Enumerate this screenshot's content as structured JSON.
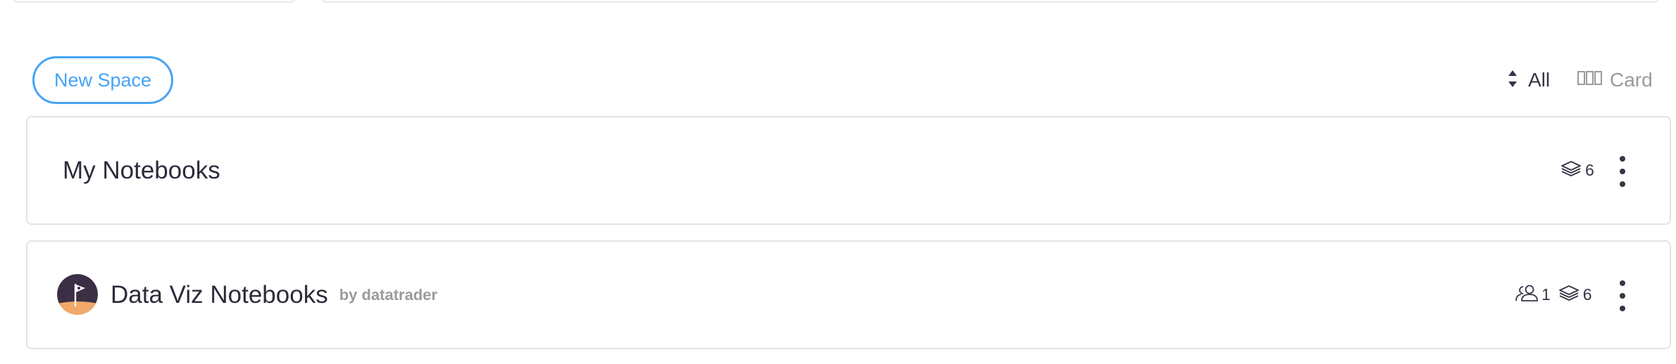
{
  "toolbar": {
    "new_space_label": "New Space",
    "sort_label": "All",
    "view_label": "Card"
  },
  "spaces": [
    {
      "title": "My Notebooks",
      "notebook_count": "6",
      "icons": [
        "layers-icon",
        "more-vertical-icon"
      ]
    },
    {
      "title": "Data Viz Notebooks",
      "byline": "by datatrader",
      "member_count": "1",
      "notebook_count": "6",
      "icons": [
        "avatar-flag-icon",
        "users-icon",
        "layers-icon",
        "more-vertical-icon"
      ]
    }
  ],
  "colors": {
    "accent": "#45a4f4",
    "text": "#2f2a3a",
    "muted": "#9b9b9b",
    "border": "#e3e3e3",
    "avatar_bg": "#3b2f45",
    "avatar_sand": "#f2a96a"
  }
}
